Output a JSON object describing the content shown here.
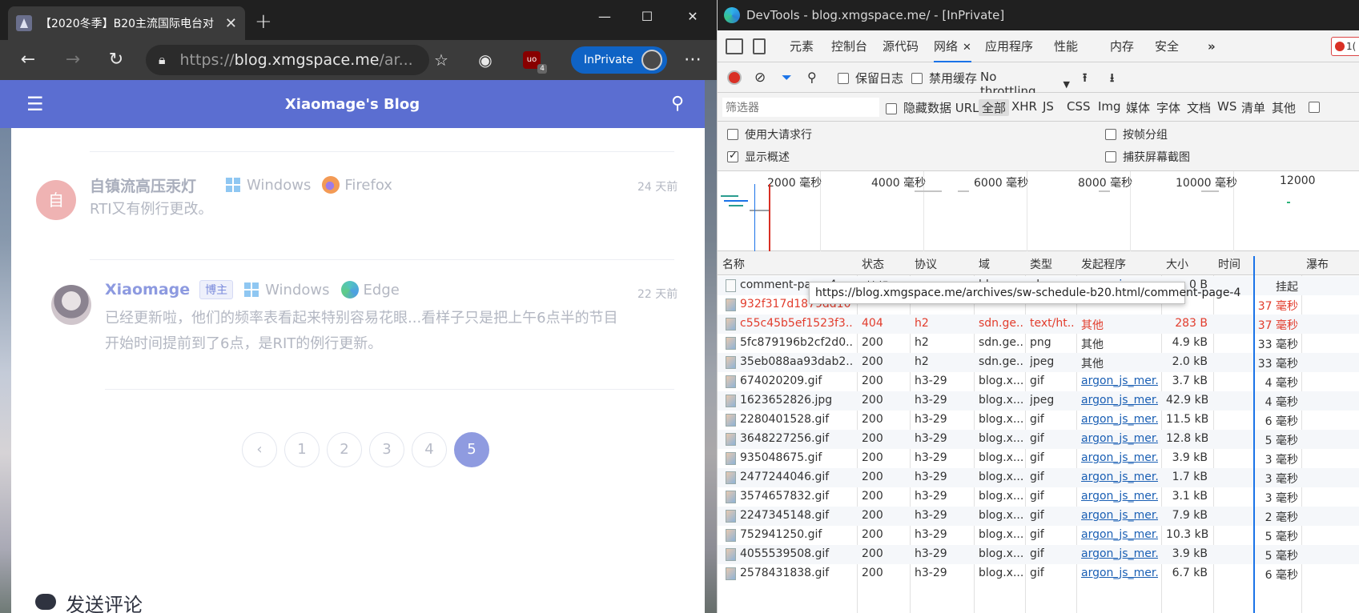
{
  "browser": {
    "tab_title": "【2020冬季】B20主流国际电台对",
    "url_prefix": "https://",
    "url_host": "blog.xmgspace.me",
    "url_path": "/ar...",
    "inprivate_label": "InPrivate",
    "ublock_count": "4"
  },
  "page": {
    "site_title": "Xiaomage's Blog",
    "comments": [
      {
        "avatar_text": "自",
        "author": "自镇流高压汞灯",
        "os": "Windows",
        "browser": "Firefox",
        "time": "24 天前",
        "text": "RTI又有例行更改。"
      },
      {
        "author": "Xiaomage",
        "badge": "博主",
        "os": "Windows",
        "browser": "Edge",
        "time": "22 天前",
        "text_line1": "已经更新啦，他们的频率表看起来特别容易花眼...看样子只是把上午6点半的节目",
        "text_line2": "开始时间提前到了6点，是RIT的例行更新。"
      }
    ],
    "pager": [
      "‹",
      "1",
      "2",
      "3",
      "4",
      "5"
    ],
    "pager_current": "5",
    "send_comment": "发送评论"
  },
  "devtools": {
    "title": "DevTools - blog.xmgspace.me/ - [InPrivate]",
    "tabs": [
      "元素",
      "控制台",
      "源代码",
      "网络",
      "应用程序",
      "性能",
      "内存",
      "安全"
    ],
    "active_tab": "网络",
    "error_count": "1(",
    "toolbar": {
      "preserve_log": "保留日志",
      "disable_cache": "禁用缓存",
      "throttling": "No throttling"
    },
    "filter": {
      "placeholder": "筛选器",
      "hide_data_url": "隐藏数据 URL",
      "types": [
        "全部",
        "XHR",
        "JS",
        "CSS",
        "Img",
        "媒体",
        "字体",
        "文档",
        "WS",
        "清单",
        "其他"
      ]
    },
    "options": {
      "big_rows": "使用大请求行",
      "group_by_frame": "按帧分组",
      "show_overview": "显示概述",
      "capture_screenshots": "捕获屏幕截图",
      "show_overview_checked": true
    },
    "overview_ticks": [
      "2000 毫秒",
      "4000 毫秒",
      "6000 毫秒",
      "8000 毫秒",
      "10000 毫秒",
      "12000"
    ],
    "columns": [
      "名称",
      "状态",
      "协议",
      "域",
      "类型",
      "发起程序",
      "大小",
      "时间",
      "瀑布"
    ],
    "tooltip": "https://blog.xmgspace.me/archives/sw-schedule-b20.html/comment-page-4",
    "rows": [
      {
        "name": "comment-page-4",
        "status": "(挂起)",
        "protocol": "",
        "domain": "blog.x...",
        "type": "xhr",
        "initiator": "argon_js_mer...",
        "size": "0 B",
        "time": "挂起",
        "err": false,
        "link": true
      },
      {
        "name": "932f317d1879dd10...",
        "status": "",
        "protocol": "",
        "domain": "",
        "type": "",
        "initiator": "",
        "size": "",
        "time": "37 毫秒",
        "err": true,
        "link": false
      },
      {
        "name": "c55c45b5ef1523f3...",
        "status": "404",
        "protocol": "h2",
        "domain": "sdn.ge...",
        "type": "text/ht...",
        "initiator": "其他",
        "size": "283 B",
        "time": "37 毫秒",
        "err": true,
        "link": false
      },
      {
        "name": "5fc879196b2cf2d0...",
        "status": "200",
        "protocol": "h2",
        "domain": "sdn.ge...",
        "type": "png",
        "initiator": "其他",
        "size": "4.9 kB",
        "time": "33 毫秒",
        "err": false,
        "link": false
      },
      {
        "name": "35eb088aa93dab2...",
        "status": "200",
        "protocol": "h2",
        "domain": "sdn.ge...",
        "type": "jpeg",
        "initiator": "其他",
        "size": "2.0 kB",
        "time": "33 毫秒",
        "err": false,
        "link": false
      },
      {
        "name": "674020209.gif",
        "status": "200",
        "protocol": "h3-29",
        "domain": "blog.x...",
        "type": "gif",
        "initiator": "argon_js_mer...",
        "size": "3.7 kB",
        "time": "4 毫秒",
        "err": false,
        "link": true
      },
      {
        "name": "1623652826.jpg",
        "status": "200",
        "protocol": "h3-29",
        "domain": "blog.x...",
        "type": "jpeg",
        "initiator": "argon_js_mer...",
        "size": "42.9 kB",
        "time": "4 毫秒",
        "err": false,
        "link": true
      },
      {
        "name": "2280401528.gif",
        "status": "200",
        "protocol": "h3-29",
        "domain": "blog.x...",
        "type": "gif",
        "initiator": "argon_js_mer...",
        "size": "11.5 kB",
        "time": "6 毫秒",
        "err": false,
        "link": true
      },
      {
        "name": "3648227256.gif",
        "status": "200",
        "protocol": "h3-29",
        "domain": "blog.x...",
        "type": "gif",
        "initiator": "argon_js_mer...",
        "size": "12.8 kB",
        "time": "5 毫秒",
        "err": false,
        "link": true
      },
      {
        "name": "935048675.gif",
        "status": "200",
        "protocol": "h3-29",
        "domain": "blog.x...",
        "type": "gif",
        "initiator": "argon_js_mer...",
        "size": "3.9 kB",
        "time": "3 毫秒",
        "err": false,
        "link": true
      },
      {
        "name": "2477244046.gif",
        "status": "200",
        "protocol": "h3-29",
        "domain": "blog.x...",
        "type": "gif",
        "initiator": "argon_js_mer...",
        "size": "1.7 kB",
        "time": "3 毫秒",
        "err": false,
        "link": true
      },
      {
        "name": "3574657832.gif",
        "status": "200",
        "protocol": "h3-29",
        "domain": "blog.x...",
        "type": "gif",
        "initiator": "argon_js_mer...",
        "size": "3.1 kB",
        "time": "3 毫秒",
        "err": false,
        "link": true
      },
      {
        "name": "2247345148.gif",
        "status": "200",
        "protocol": "h3-29",
        "domain": "blog.x...",
        "type": "gif",
        "initiator": "argon_js_mer...",
        "size": "7.9 kB",
        "time": "2 毫秒",
        "err": false,
        "link": true
      },
      {
        "name": "752941250.gif",
        "status": "200",
        "protocol": "h3-29",
        "domain": "blog.x...",
        "type": "gif",
        "initiator": "argon_js_mer...",
        "size": "10.3 kB",
        "time": "5 毫秒",
        "err": false,
        "link": true
      },
      {
        "name": "4055539508.gif",
        "status": "200",
        "protocol": "h3-29",
        "domain": "blog.x...",
        "type": "gif",
        "initiator": "argon_js_mer...",
        "size": "3.9 kB",
        "time": "5 毫秒",
        "err": false,
        "link": true
      },
      {
        "name": "2578431838.gif",
        "status": "200",
        "protocol": "h3-29",
        "domain": "blog.x...",
        "type": "gif",
        "initiator": "argon_js_mer...",
        "size": "6.7 kB",
        "time": "6 毫秒",
        "err": false,
        "link": true
      }
    ]
  }
}
